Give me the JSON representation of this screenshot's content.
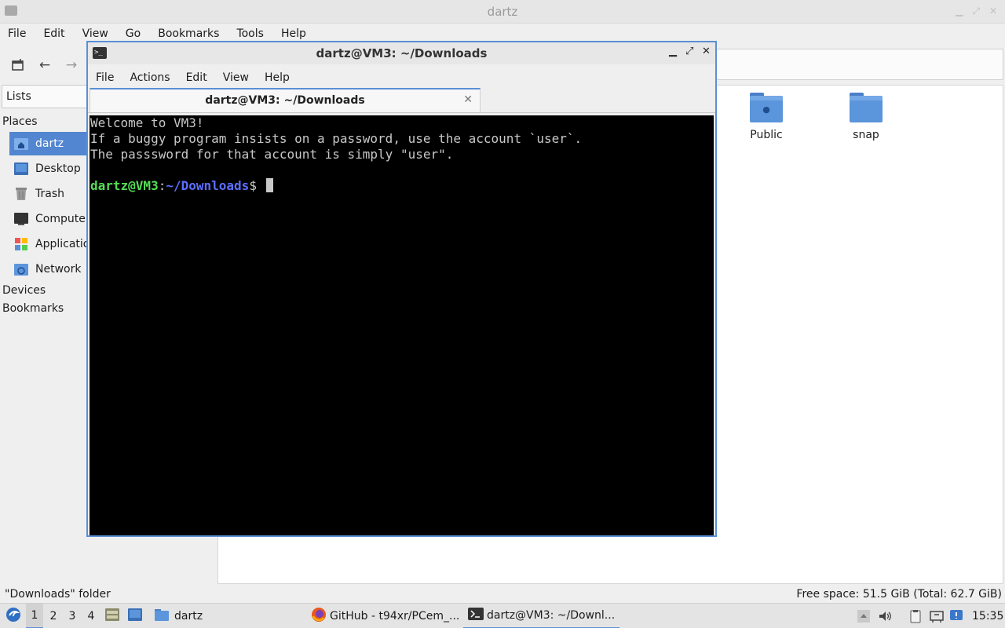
{
  "file_manager": {
    "title": "dartz",
    "menu": [
      "File",
      "Edit",
      "View",
      "Go",
      "Bookmarks",
      "Tools",
      "Help"
    ],
    "side_combo": "Lists",
    "places_heading": "Places",
    "places": [
      {
        "label": "dartz",
        "icon": "home-icon",
        "selected": true
      },
      {
        "label": "Desktop",
        "icon": "desktop-icon"
      },
      {
        "label": "Trash",
        "icon": "trash-icon"
      },
      {
        "label": "Computer",
        "icon": "computer-icon"
      },
      {
        "label": "Applications",
        "icon": "applications-icon"
      },
      {
        "label": "Network",
        "icon": "network-icon"
      }
    ],
    "devices_heading": "Devices",
    "bookmarks_heading": "Bookmarks",
    "folders": [
      {
        "label": "Public",
        "icon": "public-folder-icon"
      },
      {
        "label": "snap",
        "icon": "folder-icon"
      }
    ],
    "status_left": "\"Downloads\" folder",
    "status_right": "Free space: 51.5 GiB (Total: 62.7 GiB)"
  },
  "terminal": {
    "title": "dartz@VM3: ~/Downloads",
    "menu": [
      "File",
      "Actions",
      "Edit",
      "View",
      "Help"
    ],
    "tab_title": "dartz@VM3: ~/Downloads",
    "lines": [
      "Welcome to VM3!",
      "If a buggy program insists on a password, use the account `user`.",
      "The passsword for that account is simply \"user\"."
    ],
    "prompt_user": "dartz@VM3",
    "prompt_sep": ":",
    "prompt_path": "~/Downloads",
    "prompt_end": "$ "
  },
  "taskbar": {
    "workspaces": [
      "1",
      "2",
      "3",
      "4"
    ],
    "active_workspace": "1",
    "quick_launch_label": "dartz",
    "tasks": [
      {
        "label": "GitHub - t94xr/PCem_...",
        "icon": "firefox-icon"
      },
      {
        "label": "dartz@VM3: ~/Downl...",
        "icon": "terminal-icon",
        "active": true
      }
    ],
    "clock": "15:35"
  },
  "colors": {
    "accent": "#5a8fd6",
    "selection": "#5286d0",
    "prompt_user": "#55dd55",
    "prompt_path": "#5b6eff"
  }
}
